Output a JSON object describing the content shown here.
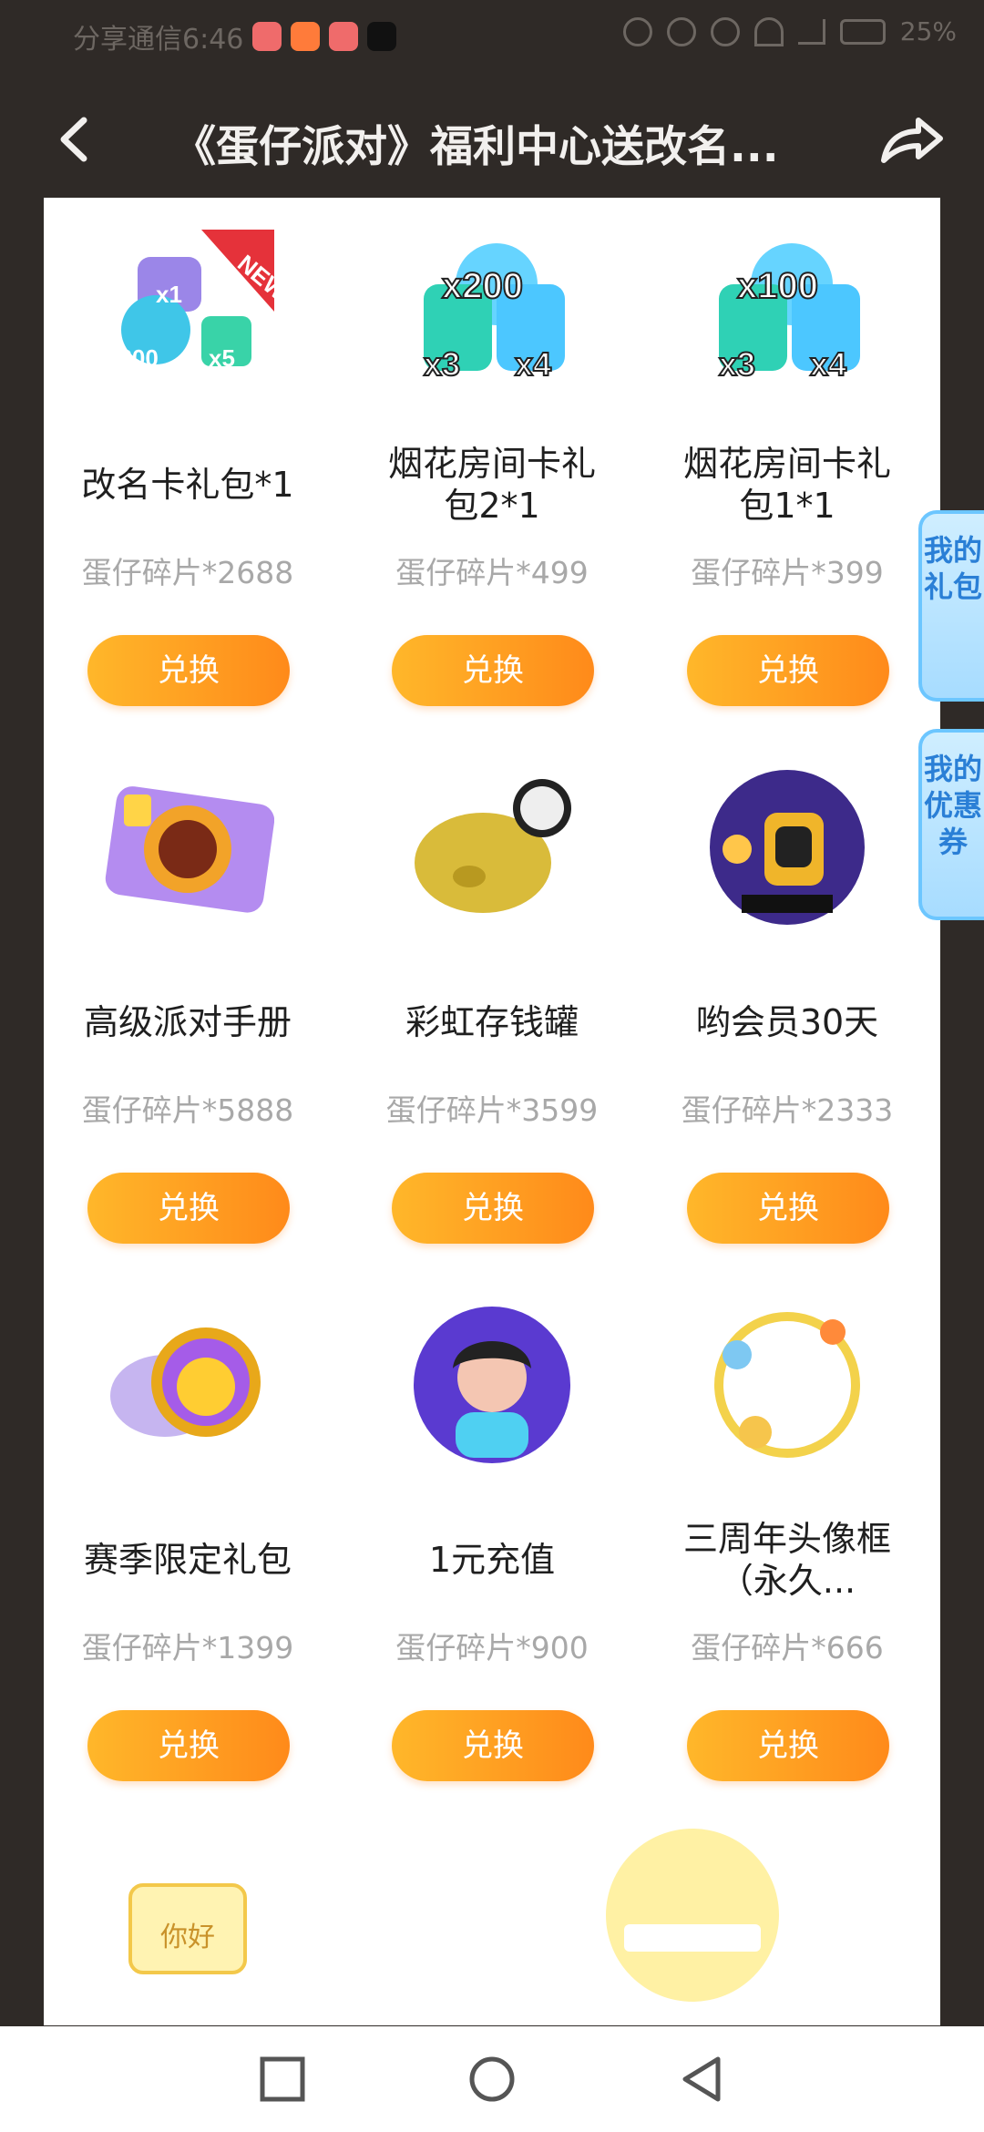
{
  "status_bar": {
    "left_text": "分享通信6:46",
    "battery": "25%"
  },
  "header": {
    "title": "《蛋仔派对》福利中心送改名..."
  },
  "side_tabs": [
    {
      "label": "我的礼包"
    },
    {
      "label": "我的优惠券"
    }
  ],
  "items": [
    {
      "title": "改名卡礼包*1",
      "price": "蛋仔碎片*2688",
      "button": "兑换",
      "icon": "rename-card-gift-icon"
    },
    {
      "title": "烟花房间卡礼包2*1",
      "price": "蛋仔碎片*499",
      "button": "兑换",
      "icon": "fireworks-room-card-icon"
    },
    {
      "title": "烟花房间卡礼包1*1",
      "price": "蛋仔碎片*399",
      "button": "兑换",
      "icon": "fireworks-room-card-icon"
    },
    {
      "title": "高级派对手册",
      "price": "蛋仔碎片*5888",
      "button": "兑换",
      "icon": "party-handbook-icon"
    },
    {
      "title": "彩虹存钱罐",
      "price": "蛋仔碎片*3599",
      "button": "兑换",
      "icon": "piggy-bank-icon"
    },
    {
      "title": "哟会员30天",
      "price": "蛋仔碎片*2333",
      "button": "兑换",
      "icon": "membership-icon"
    },
    {
      "title": "赛季限定礼包",
      "price": "蛋仔碎片*1399",
      "button": "兑换",
      "icon": "season-gift-icon"
    },
    {
      "title": "1元充值",
      "price": "蛋仔碎片*900",
      "button": "兑换",
      "icon": "recharge-icon"
    },
    {
      "title": "三周年头像框（永久...",
      "price": "蛋仔碎片*666",
      "button": "兑换",
      "icon": "avatar-frame-icon"
    }
  ],
  "partial_items": [
    {
      "text": "你好",
      "icon": "greeting-card-icon"
    },
    {
      "text": "",
      "icon": "anniversary-badge-icon"
    }
  ]
}
